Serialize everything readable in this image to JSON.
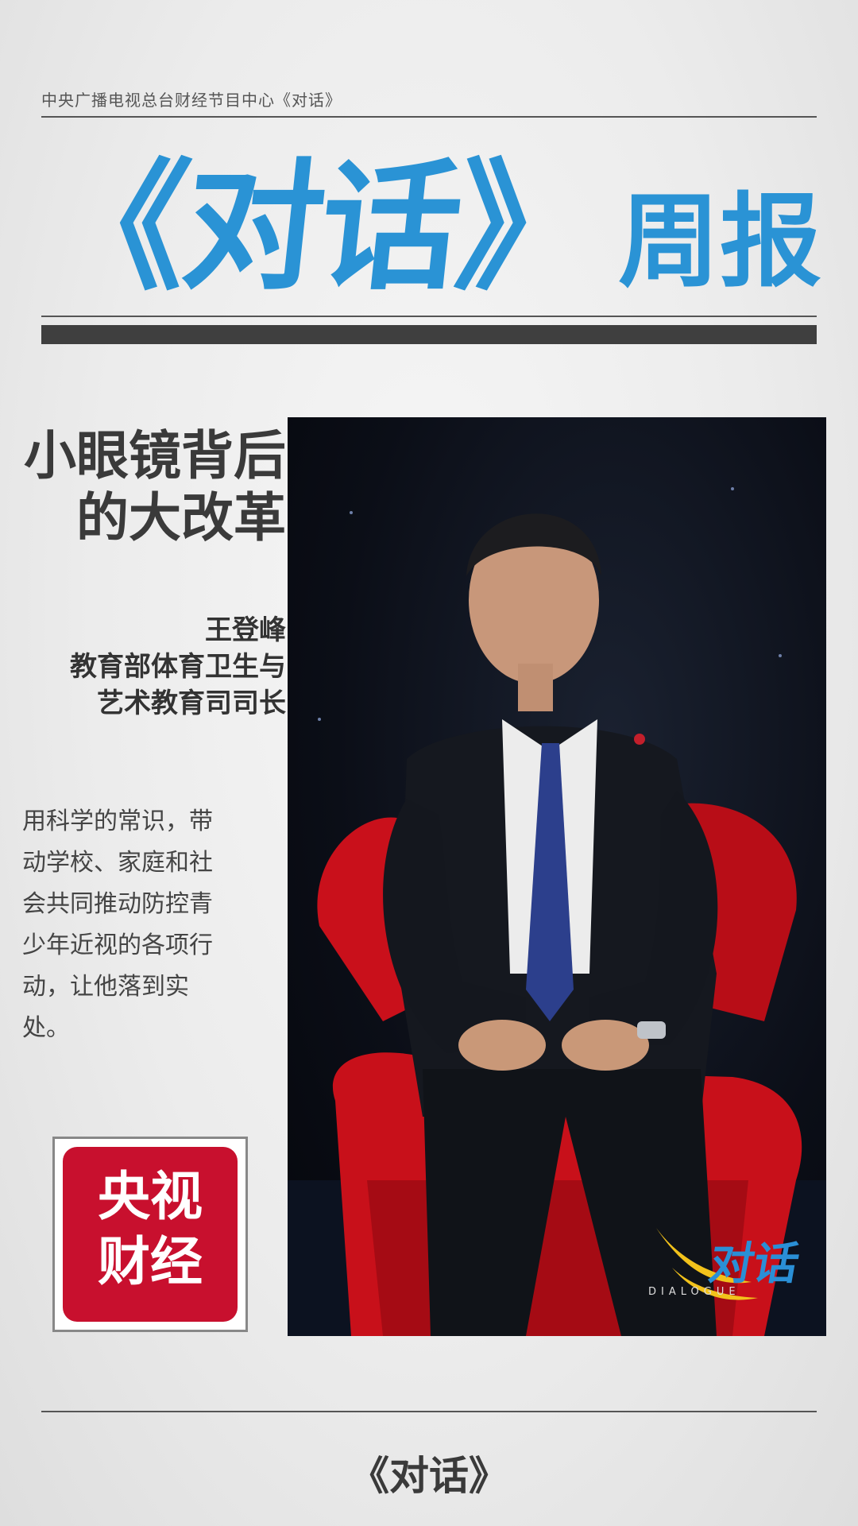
{
  "header": {
    "source_line": "中央广播电视总台财经节目中心《对话》",
    "masthead_title": "《对话》",
    "masthead_subtitle": "周报"
  },
  "article": {
    "headline_lines": [
      "小眼镜背后",
      "的大改革"
    ],
    "speaker_name": "王登峰",
    "speaker_title_lines": [
      "教育部体育卫生与",
      "艺术教育司司长"
    ],
    "quote_lines": [
      "用科学的常识，带",
      "动学校、家庭和社",
      "会共同推动防控青",
      "少年近视的各项行",
      "动，让他落到实",
      "处。"
    ]
  },
  "logo": {
    "line1": "央视",
    "line2": "财经"
  },
  "photo": {
    "watermark_cn": "对话",
    "watermark_en": "DIALOGUE"
  },
  "footer": {
    "title": "《对话》"
  },
  "colors": {
    "accent_blue": "#2a93d5",
    "logo_red": "#c8102e",
    "dark_bar": "#3f3f3f"
  }
}
